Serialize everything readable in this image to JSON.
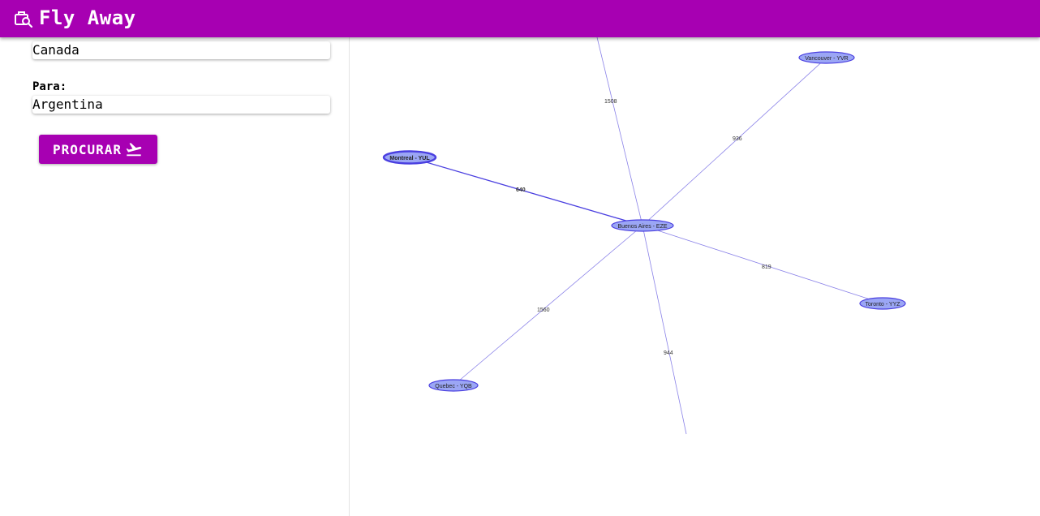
{
  "app": {
    "title": "Fly Away",
    "logo_icon": "luggage-search-icon",
    "brand_color": "#a700b2"
  },
  "form": {
    "from_value": "Canada",
    "to_label": "Para:",
    "to_value": "Argentina",
    "search_button_label": "PROCURAR",
    "search_button_icon": "airplane-takeoff-icon"
  },
  "graph": {
    "center_node": "Buenos Aires - EZE",
    "nodes": [
      {
        "id": "eze",
        "label": "Buenos Aires - EZE"
      },
      {
        "id": "yul",
        "label": "Montreal - YUL",
        "selected": true
      },
      {
        "id": "yvr",
        "label": "Vancouver - YVR"
      },
      {
        "id": "yyz",
        "label": "Toronto - YYZ"
      },
      {
        "id": "yqb",
        "label": "Quebec - YQB"
      }
    ],
    "edges": [
      {
        "from": "eze",
        "to": "yul",
        "label": "640",
        "highlighted": true
      },
      {
        "from": "eze",
        "to": "yvr",
        "label": "936"
      },
      {
        "from": "eze",
        "to": "yyz",
        "label": "819"
      },
      {
        "from": "eze",
        "to": "yqb",
        "label": "1560"
      },
      {
        "from": "eze",
        "to": "offscreen-top",
        "label": "1508"
      },
      {
        "from": "eze",
        "to": "offscreen-bottom",
        "label": "944"
      }
    ],
    "node_fill": "#9ba6f5",
    "node_stroke": "#4a3fe0",
    "edge_color": "#8a82e8"
  }
}
